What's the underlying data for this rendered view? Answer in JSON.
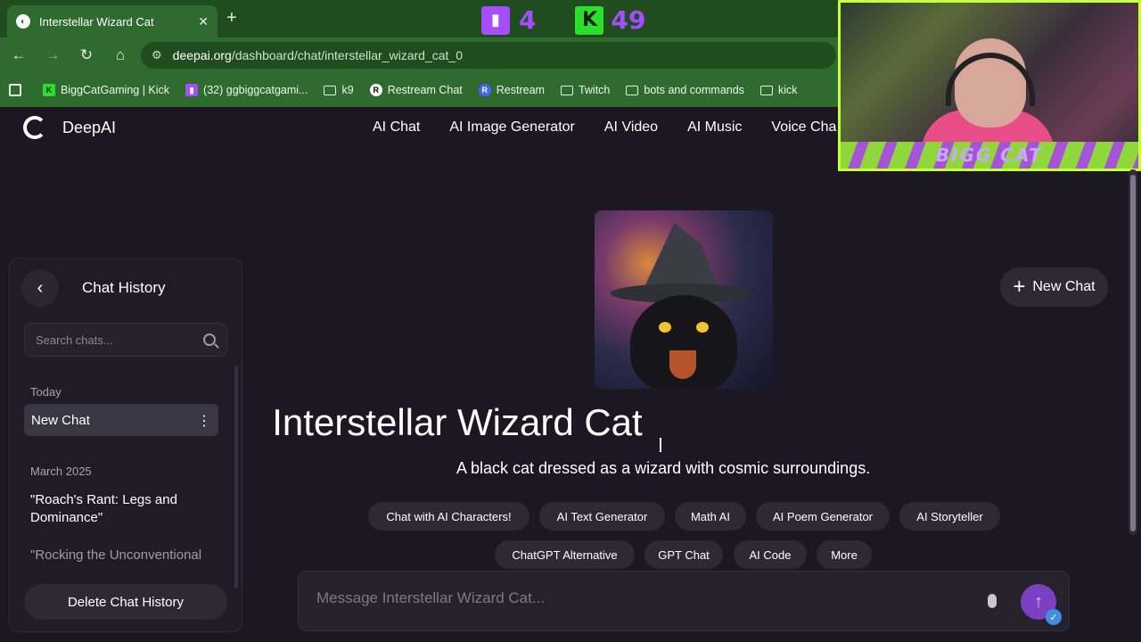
{
  "browser": {
    "tab_title": "Interstellar Wizard Cat",
    "url_host": "deepai.org",
    "url_path": "/dashboard/chat/interstellar_wizard_cat_0",
    "bookmarks": [
      {
        "label": "BiggCatGaming | Kick",
        "icon": "kick-icon"
      },
      {
        "label": "(32) ggbiggcatgami...",
        "icon": "twitch-icon"
      },
      {
        "label": "k9",
        "icon": "folder-icon"
      },
      {
        "label": "Restream Chat",
        "icon": "restream-icon"
      },
      {
        "label": "Restream",
        "icon": "restream-icon"
      },
      {
        "label": "Twitch",
        "icon": "folder-icon"
      },
      {
        "label": "bots and commands",
        "icon": "folder-icon"
      },
      {
        "label": "kick",
        "icon": "folder-icon"
      }
    ]
  },
  "stream_overlay": {
    "twitch_count": "4",
    "kick_count": "49",
    "webcam_banner": "BIGG CAT"
  },
  "site": {
    "brand": "DeepAI",
    "nav": [
      "AI Chat",
      "AI Image Generator",
      "AI Video",
      "AI Music",
      "Voice Cha"
    ]
  },
  "sidebar": {
    "title": "Chat History",
    "search_placeholder": "Search chats...",
    "sections": [
      {
        "label": "Today",
        "items": [
          "New Chat"
        ]
      },
      {
        "label": "March 2025",
        "items": [
          "\"Roach's Rant: Legs and Dominance\"",
          "\"Rocking the Unconventional"
        ]
      }
    ],
    "delete_label": "Delete Chat History"
  },
  "main": {
    "character_name": "Interstellar Wizard Cat",
    "character_description": "A black cat dressed as a wizard with cosmic surroundings.",
    "new_chat_label": "New Chat",
    "chips": [
      "Chat with AI Characters!",
      "AI Text Generator",
      "Math AI",
      "AI Poem Generator",
      "AI Storyteller",
      "ChatGPT Alternative",
      "GPT Chat",
      "AI Code",
      "More"
    ],
    "composer_placeholder": "Message Interstellar Wizard Cat..."
  },
  "colors": {
    "browser_green": "#2f6a2f",
    "page_bg": "#1b1824",
    "accent_purple": "#7b3fc2",
    "kick_green": "#2ae02a",
    "twitch_purple": "#a64dff"
  }
}
